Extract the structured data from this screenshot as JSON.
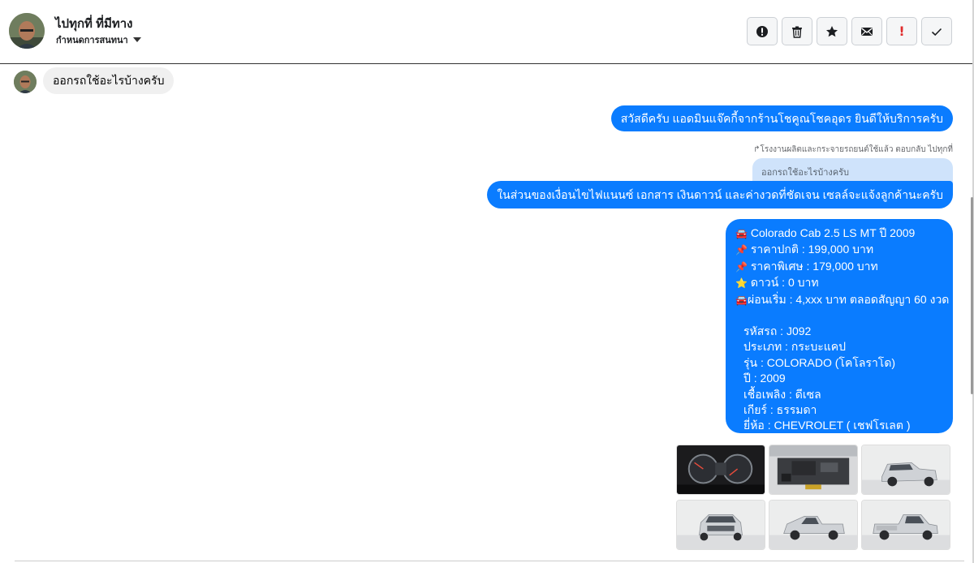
{
  "header": {
    "contact_name": "ไปทุกที่ ที่มีทาง",
    "conversation_label": "กำหนดการสนทนา"
  },
  "toolbar": [
    {
      "name": "alert-circle-button",
      "icon": "alert-circle-icon"
    },
    {
      "name": "trash-button",
      "icon": "trash-icon"
    },
    {
      "name": "star-button",
      "icon": "star-icon"
    },
    {
      "name": "mail-button",
      "icon": "envelope-icon"
    },
    {
      "name": "mark-important-button",
      "icon": "exclamation-icon",
      "glyph": "!"
    },
    {
      "name": "mark-done-button",
      "icon": "checkmark-icon"
    }
  ],
  "messages": {
    "incoming_1": "ออกรถใช้อะไรบ้างครับ",
    "outgoing_1": "สวัสดีครับ แอดมินแจ๊คกี้จากร้านโชคูณโชคอุดร ยินดีให้บริการครับ",
    "reply_note": "↱โรงงานผลิตและกระจายรถยนต์ใช้แล้ว ตอบกลับ ไปทุกที่",
    "quoted": "ออกรถใช้อะไรบ้างครับ",
    "outgoing_2": "ในส่วนของเงื่อนไขไฟแนนซ์ เอกสาร เงินดาวน์ และค่างวดที่ชัดเจน เซลล์จะแจ้งลูกค้านะครับ",
    "listing": {
      "title": "Colorado Cab 2.5 LS MT ปี 2009",
      "normal_price": "ราคาปกติ : 199,000 บาท",
      "special_price": "ราคาพิเศษ : 179,000 บาท",
      "down": "ดาวน์ : 0 บาท",
      "installment": "ผ่อนเริ่ม : 4,xxx บาท ตลอดสัญญา 60 งวด",
      "car_code": "รหัสรถ : J092",
      "type": "ประเภท : กระบะแคป",
      "model": "รุ่น : COLORADO (โคโลราโด)",
      "year": "ปี : 2009",
      "fuel": "เชื้อเพลิง : ดีเซล",
      "gear": "เกียร์ : ธรรมดา",
      "brand": "ยี่ห้อ : CHEVROLET ( เชฟโรเลต )"
    }
  },
  "icons": {
    "car": "🚘",
    "pin": "📌",
    "star": "⭐"
  },
  "colors": {
    "bubble_out": "#0a7cff",
    "bubble_in": "#f0f0f0",
    "quoted_bg": "#cfe3fb",
    "important": "#e02b2b"
  }
}
